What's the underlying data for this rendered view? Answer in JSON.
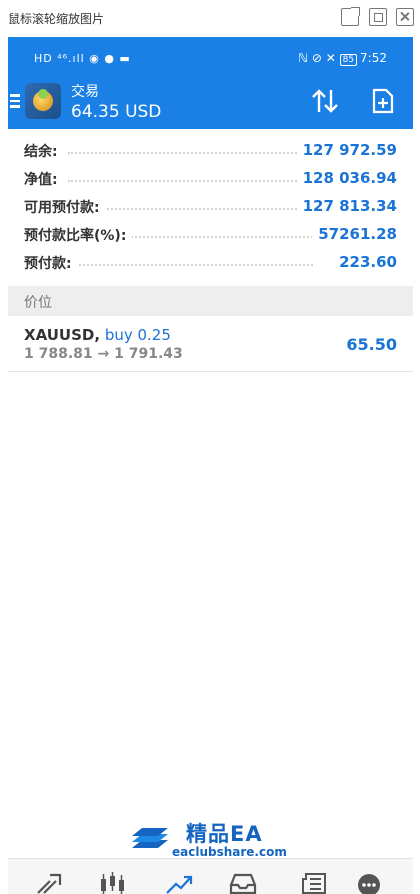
{
  "viewer": {
    "title": "鼠标滚轮缩放图片",
    "buttons": [
      "open-in-new",
      "fit",
      "close"
    ]
  },
  "status_bar": {
    "left_text": "HD ⁴⁶.ıll ◉ ● ▬",
    "battery": "85",
    "time": "7:52"
  },
  "header": {
    "title": "交易",
    "balance": "64.35 USD",
    "icons": [
      "menu-icon",
      "app-logo",
      "sort-icon",
      "new-order-icon"
    ]
  },
  "account": [
    {
      "label": "结余:",
      "value": "127 972.59"
    },
    {
      "label": "净值:",
      "value": "128 036.94"
    },
    {
      "label": "可用预付款:",
      "value": "127 813.34"
    },
    {
      "label": "预付款比率(%):",
      "value": "57261.28"
    },
    {
      "label": "预付款:",
      "value": "223.60"
    }
  ],
  "positions_section": {
    "label": "价位"
  },
  "position": {
    "symbol": "XAUUSD,",
    "side": "buy 0.25",
    "prices": "1 788.81 → 1 791.43",
    "profit": "65.50"
  },
  "watermark": {
    "title": "精品EA",
    "url": "eaclubshare.com"
  },
  "bottom_nav": {
    "items": [
      "quotes-icon",
      "chart-icon",
      "trade-icon",
      "history-icon",
      "news-icon",
      "more-icon"
    ],
    "active": "trade-icon"
  },
  "colors": {
    "header_bg": "#1a80e6",
    "value_blue": "#1a73d6",
    "section_bg": "#eeeeee"
  }
}
